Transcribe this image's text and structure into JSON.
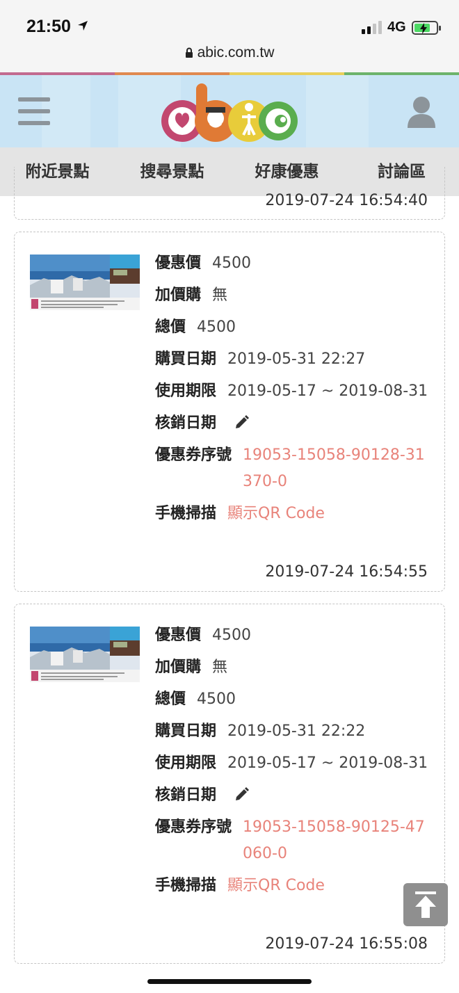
{
  "status_bar": {
    "time": "21:50",
    "network": "4G",
    "url": "abic.com.tw"
  },
  "colors": {
    "stripe": [
      "#c26a8f",
      "#e0894f",
      "#e9d05a",
      "#6db36b"
    ],
    "header_bg": "#c9e4f5",
    "nav_bg": "#e4e4e4",
    "link_pink": "#e8837a"
  },
  "header": {
    "logo_alt": "abic",
    "menu_icon": "hamburger-icon",
    "user_icon": "user-icon"
  },
  "nav": {
    "items": [
      {
        "label": "附近景點"
      },
      {
        "label": "搜尋景點"
      },
      {
        "label": "好康優惠"
      },
      {
        "label": "討論區"
      }
    ]
  },
  "partial_card": {
    "timestamp": "2019-07-24 16:54:40"
  },
  "cards": [
    {
      "price_label": "優惠價",
      "price": "4500",
      "addon_label": "加價購",
      "addon": "無",
      "total_label": "總價",
      "total": "4500",
      "purchase_label": "購買日期",
      "purchase_date": "2019-05-31 22:27",
      "validity_label": "使用期限",
      "validity": "2019-05-17 ~ 2019-08-31",
      "redeem_label": "核銷日期",
      "serial_label": "優惠券序號",
      "serial": "19053-15058-90128-31370-0",
      "scan_label": "手機掃描",
      "scan_link": "顯示QR Code",
      "timestamp": "2019-07-24 16:54:55"
    },
    {
      "price_label": "優惠價",
      "price": "4500",
      "addon_label": "加價購",
      "addon": "無",
      "total_label": "總價",
      "total": "4500",
      "purchase_label": "購買日期",
      "purchase_date": "2019-05-31 22:22",
      "validity_label": "使用期限",
      "validity": "2019-05-17 ~ 2019-08-31",
      "redeem_label": "核銷日期",
      "serial_label": "優惠券序號",
      "serial": "19053-15058-90125-47060-0",
      "scan_label": "手機掃描",
      "scan_link": "顯示QR Code",
      "timestamp": "2019-07-24 16:55:08"
    }
  ]
}
